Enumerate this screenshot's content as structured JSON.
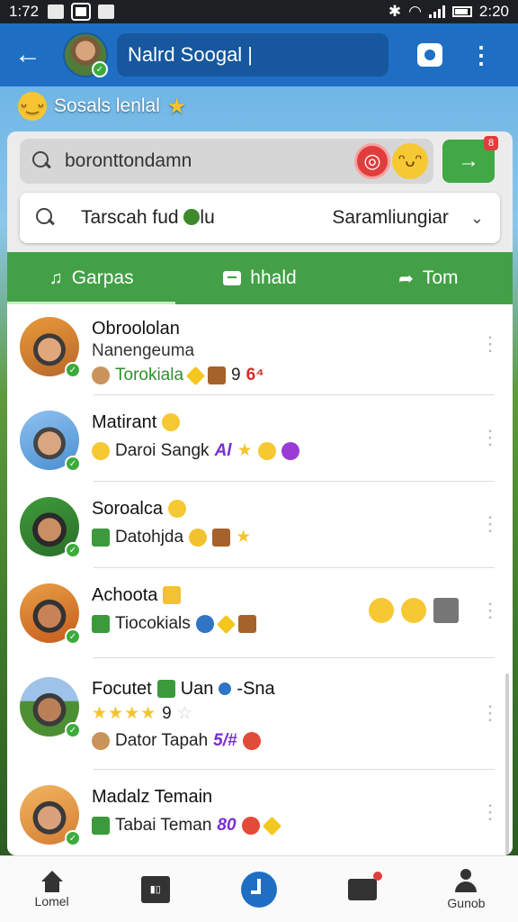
{
  "status_bar": {
    "time": "1:72",
    "time_right": "2:20"
  },
  "app_bar": {
    "title": "Nalrd Soogal |"
  },
  "greeting": {
    "text": "Sosals lenlal"
  },
  "search": {
    "placeholder": "boronttondamn",
    "go_count": "8"
  },
  "filter": {
    "left_text": "Tarscah fud",
    "left_suffix": "lu",
    "right_text": "Saramliungiar"
  },
  "tabs": [
    {
      "label": "Garpas",
      "icon": "music-icon"
    },
    {
      "label": "hhald",
      "icon": "message-icon"
    },
    {
      "label": "Tom",
      "icon": "share-icon"
    }
  ],
  "contacts": [
    {
      "name": "Obroololan",
      "sub": "Nanengeuma",
      "meta": "Torokiala",
      "meta_extra": "9",
      "meta_extra2": "6⁴"
    },
    {
      "name": "Matirant",
      "meta": "Daroi Sangk",
      "meta_extra": "Al"
    },
    {
      "name": "Soroalca",
      "meta": "Datohjda"
    },
    {
      "name": "Achoota",
      "meta": "Tiocokials"
    },
    {
      "name": "Focutet",
      "name_extra": "Uan",
      "name_extra2": "-Sna",
      "stars_extra": "9",
      "meta": "Dator Tapah",
      "meta_extra": "5/#"
    },
    {
      "name": "Madalz Temain",
      "meta": "Tabai Teman",
      "meta_extra": "80"
    }
  ],
  "bottom_nav": [
    {
      "label": "Lomel",
      "icon": "home-icon"
    },
    {
      "label": "",
      "icon": "tiles-icon"
    },
    {
      "label": "",
      "icon": "clock-icon"
    },
    {
      "label": "",
      "icon": "mail-icon"
    },
    {
      "label": "Gunob",
      "icon": "person-icon"
    }
  ],
  "colors": {
    "app_bar": "#1e6fc4",
    "tabs": "#43a047",
    "accent": "#e23d3d"
  }
}
